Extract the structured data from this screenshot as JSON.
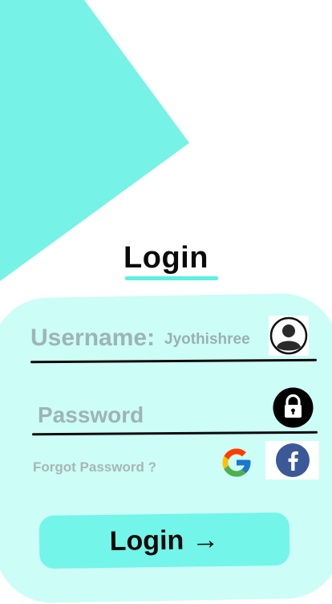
{
  "app": {
    "title": "Login"
  },
  "form": {
    "username_label": "Username:",
    "username_value": "Jyothishree",
    "password_label": "Password",
    "forgot_password": "Forgot Password ?"
  },
  "actions": {
    "login_label": "Login",
    "login_arrow": "→"
  },
  "social": {
    "google_letter": "G",
    "facebook_letter": "f"
  },
  "colors": {
    "accent": "#74f5e9",
    "card": "#ccfdf7",
    "triangle": "#76f2e6",
    "facebook": "#3b5998"
  },
  "icons": [
    "avatar-icon",
    "lock-icon",
    "google-icon",
    "facebook-icon",
    "arrow-right-icon"
  ]
}
